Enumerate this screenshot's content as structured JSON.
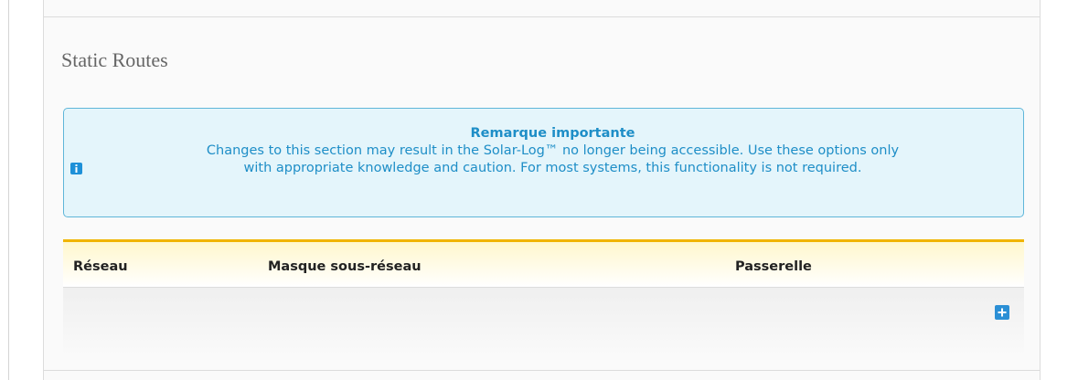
{
  "section": {
    "title": "Static Routes"
  },
  "notice": {
    "icon": "info-icon",
    "title": "Remarque importante",
    "line1": "Changes to this section may result in the Solar-Log™ no longer being accessible. Use these options only",
    "line2": "with appropriate knowledge and caution. For most systems, this functionality is not required."
  },
  "table": {
    "columns": {
      "network": "Réseau",
      "subnet_mask": "Masque sous-réseau",
      "gateway": "Passerelle"
    },
    "rows": [],
    "add_icon": "plus-icon"
  },
  "colors": {
    "notice_text": "#1e8ec7",
    "notice_border": "#5fb6d9",
    "notice_bg": "#e4f5fb",
    "table_accent": "#f0b400",
    "add_button": "#2b8fd5"
  }
}
